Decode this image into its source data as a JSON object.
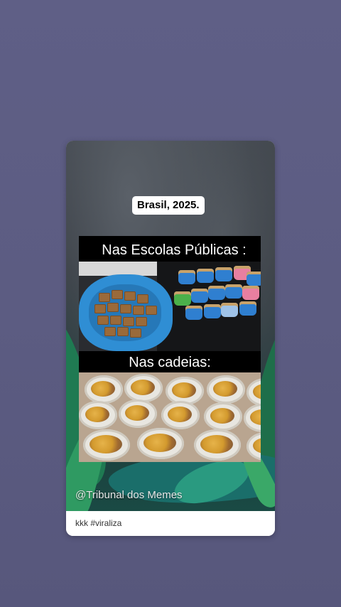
{
  "post": {
    "year_label": "Brasil, 2025.",
    "caption_top": "Nas Escolas Públicas :",
    "caption_bottom": "Nas cadeias:",
    "watermark": "@Tribunal dos Memes",
    "description": "kkk #viraliza"
  },
  "colors": {
    "page_background": "#5c5c82",
    "card_background": "#ffffff",
    "meme_background": "#000000"
  },
  "icons": {
    "photo_top": "basin-of-cookies-and-coffee-cups-photo",
    "photo_bottom": "food-trays-photo"
  }
}
